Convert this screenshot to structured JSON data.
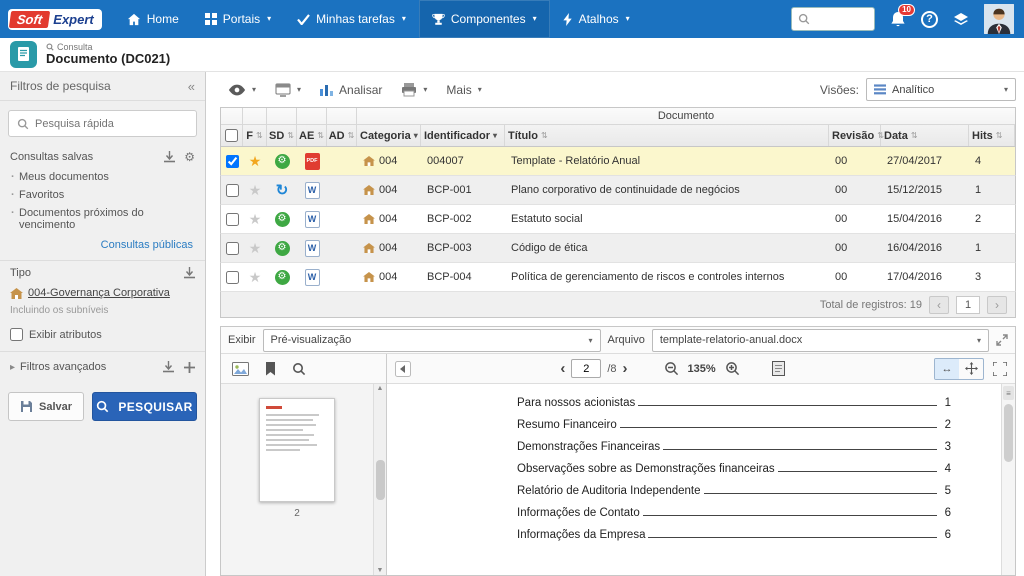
{
  "topnav": {
    "logo_part1": "Soft",
    "logo_part2": "Expert",
    "items": [
      {
        "label": "Home"
      },
      {
        "label": "Portais"
      },
      {
        "label": "Minhas tarefas"
      },
      {
        "label": "Componentes"
      },
      {
        "label": "Atalhos"
      }
    ],
    "badge": "10"
  },
  "header": {
    "crumb": "Consulta",
    "title": "Documento (DC021)"
  },
  "sidebar": {
    "title": "Filtros de pesquisa",
    "quick_search_placeholder": "Pesquisa rápida",
    "saved": {
      "title": "Consultas salvas",
      "items": [
        "Meus documentos",
        "Favoritos",
        "Documentos próximos do vencimento"
      ],
      "public_link": "Consultas públicas"
    },
    "tipo": {
      "title": "Tipo",
      "value": "004-Governança Corporativa",
      "note": "Incluindo os subníveis",
      "checkbox": "Exibir atributos"
    },
    "advanced": "Filtros avançados",
    "save": "Salvar",
    "search": "PESQUISAR"
  },
  "toolbar": {
    "analyze": "Analisar",
    "more": "Mais",
    "views_label": "Visões:",
    "views_value": "Analítico"
  },
  "table": {
    "group": "Documento",
    "cols": {
      "f": "F",
      "sd": "SD",
      "ae": "AE",
      "ad": "AD",
      "categoria": "Categoria",
      "identificador": "Identificador",
      "titulo": "Título",
      "revisao": "Revisão",
      "data": "Data",
      "hits": "Hits"
    },
    "rows": [
      {
        "checked": true,
        "favorite": true,
        "sd": "released",
        "file": "pdf",
        "categoria": "004",
        "id": "004007",
        "titulo": "Template - Relatório Anual",
        "rev": "00",
        "data": "27/04/2017",
        "hits": "4"
      },
      {
        "checked": false,
        "favorite": false,
        "sd": "revision",
        "file": "doc",
        "categoria": "004",
        "id": "BCP-001",
        "titulo": "Plano corporativo de continuidade de negócios",
        "rev": "00",
        "data": "15/12/2015",
        "hits": "1"
      },
      {
        "checked": false,
        "favorite": false,
        "sd": "released",
        "file": "doc",
        "categoria": "004",
        "id": "BCP-002",
        "titulo": "Estatuto social",
        "rev": "00",
        "data": "15/04/2016",
        "hits": "2"
      },
      {
        "checked": false,
        "favorite": false,
        "sd": "released",
        "file": "doc",
        "categoria": "004",
        "id": "BCP-003",
        "titulo": "Código de ética",
        "rev": "00",
        "data": "16/04/2016",
        "hits": "1"
      },
      {
        "checked": false,
        "favorite": false,
        "sd": "released",
        "file": "doc",
        "categoria": "004",
        "id": "BCP-004",
        "titulo": "Política de gerenciamento de riscos e controles internos",
        "rev": "00",
        "data": "17/04/2016",
        "hits": "3"
      }
    ],
    "footer": {
      "total": "Total de registros: 19",
      "page": "1"
    }
  },
  "preview": {
    "exibir_label": "Exibir",
    "exibir_value": "Pré-visualização",
    "arquivo_label": "Arquivo",
    "arquivo_value": "template-relatorio-anual.docx",
    "page_value": "2",
    "page_total": "/8",
    "zoom": "135%",
    "thumb_page": "2",
    "toc": [
      {
        "t": "Para nossos acionistas",
        "p": "1"
      },
      {
        "t": "Resumo Financeiro",
        "p": "2"
      },
      {
        "t": "Demonstrações Financeiras",
        "p": "3"
      },
      {
        "t": "Observações sobre as Demonstrações financeiras",
        "p": "4"
      },
      {
        "t": "Relatório de Auditoria Independente",
        "p": "5"
      },
      {
        "t": "Informações de Contato",
        "p": "6"
      },
      {
        "t": "Informações da Empresa",
        "p": "6"
      }
    ]
  }
}
